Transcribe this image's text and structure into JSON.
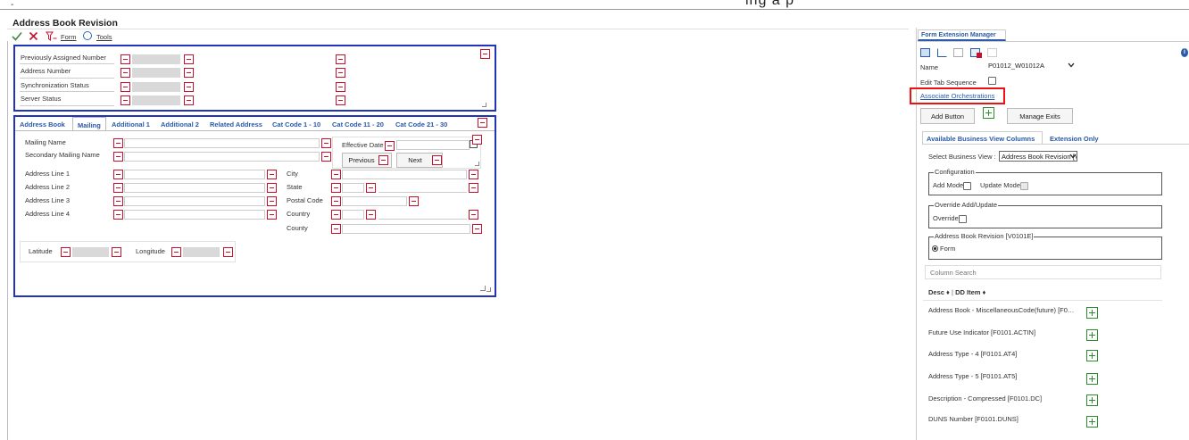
{
  "topbar": {
    "dash": "-",
    "cut_text": "ing   a p"
  },
  "form": {
    "title": "Address Book Revision",
    "form_menu": "Form",
    "tools_menu": "Tools"
  },
  "header_fields": [
    "Previously Assigned Number",
    "Address Number",
    "Synchronization Status",
    "Server Status"
  ],
  "tabs": [
    "Address Book",
    "Mailing",
    "Additional 1",
    "Additional 2",
    "Related Address",
    "Cat Code 1 - 10",
    "Cat Code 11 - 20",
    "Cat Code 21 - 30"
  ],
  "mailing": {
    "mailing_name": "Mailing Name",
    "secondary_mailing_name": "Secondary Mailing Name",
    "effective_date": "Effective Date",
    "previous": "Previous",
    "next": "Next",
    "address_lines": [
      "Address Line 1",
      "Address Line 2",
      "Address Line 3",
      "Address Line 4"
    ],
    "city": "City",
    "state": "State",
    "postal_code": "Postal Code",
    "country": "Country",
    "county": "County",
    "latitude": "Latitude",
    "longitude": "Longitude"
  },
  "fem": {
    "title": "Form Extension Manager",
    "name_label": "Name",
    "name_value": "P01012_W01012A",
    "edit_tab_sequence": "Edit Tab Sequence",
    "associate": "Associate Orchestrations",
    "add_button": "Add Button",
    "manage_exits": "Manage Exits",
    "tab_active": "Available Business View Columns",
    "tab_other": "Extension Only",
    "select_bv_label": "Select Business View :",
    "select_bv_value": "Address Book Revision [V…",
    "configuration": "Configuration",
    "add_mode": "Add Mode",
    "update_mode": "Update Mode",
    "override_group": "Override Add/Update",
    "override": "Override",
    "bv_group": "Address Book Revision [V0101E]",
    "form_radio": "Form",
    "search_placeholder": "Column Search",
    "col_desc": "Desc ♦",
    "col_dd": "DD Item ♦",
    "columns": [
      "Address Book - MiscellaneousCode(future) [F0…",
      "Future Use Indicator [F0101.ACTIN]",
      "Address Type - 4 [F0101.AT4]",
      "Address Type - 5 [F0101.AT5]",
      "Description - Compressed [F0101.DC]",
      "DUNS Number [F0101.DUNS]"
    ]
  },
  "colors": {
    "tab_blue": "#2a5aa8",
    "border_blue": "#2233bb",
    "minus_red": "#c8102e",
    "plus_green": "#2e8b2e",
    "highlight_red": "#e11"
  }
}
